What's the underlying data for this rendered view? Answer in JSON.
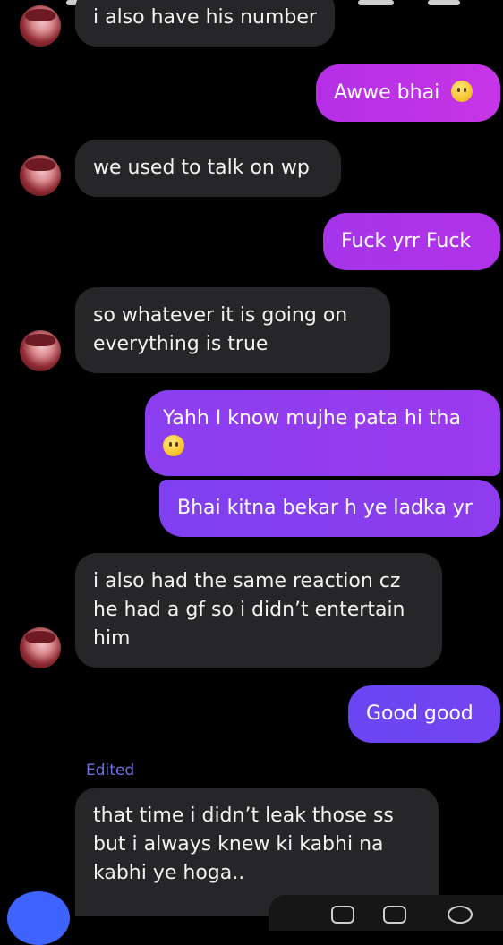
{
  "colors": {
    "background": "#000000",
    "incoming_bubble": "#262628",
    "outgoing_gradient_start": "#8a3ef0",
    "outgoing_gradient_end": "#b02fe8",
    "edited_label": "#6b72e6",
    "compose_button": "#3f63ff"
  },
  "messages": [
    {
      "direction": "incoming",
      "lines": [
        "i also have his number"
      ]
    },
    {
      "direction": "outgoing",
      "lines": [
        "Awwe bhai"
      ],
      "emoji": "slightly-smiling-face"
    },
    {
      "direction": "incoming",
      "lines": [
        "we used to talk on wp"
      ]
    },
    {
      "direction": "outgoing",
      "lines": [
        "Fuck yrr Fuck"
      ]
    },
    {
      "direction": "incoming",
      "lines": [
        "so whatever it is going on",
        "everything is true"
      ]
    },
    {
      "direction": "outgoing",
      "lines": [
        "Yahh I know mujhe pata hi tha"
      ],
      "emoji": "face-holding-back-tears"
    },
    {
      "direction": "outgoing",
      "lines": [
        "Bhai kitna bekar h ye ladka yr"
      ]
    },
    {
      "direction": "incoming",
      "lines": [
        "i also had the same reaction cz",
        "he had a gf so i didn’t entertain",
        "him"
      ]
    },
    {
      "direction": "outgoing",
      "lines": [
        "Good good"
      ]
    },
    {
      "direction": "incoming",
      "edited_label": "Edited",
      "lines": [
        "that time i didn’t leak those ss",
        "but i always knew ki kabhi na",
        "kabhi ye hoga.."
      ]
    }
  ]
}
